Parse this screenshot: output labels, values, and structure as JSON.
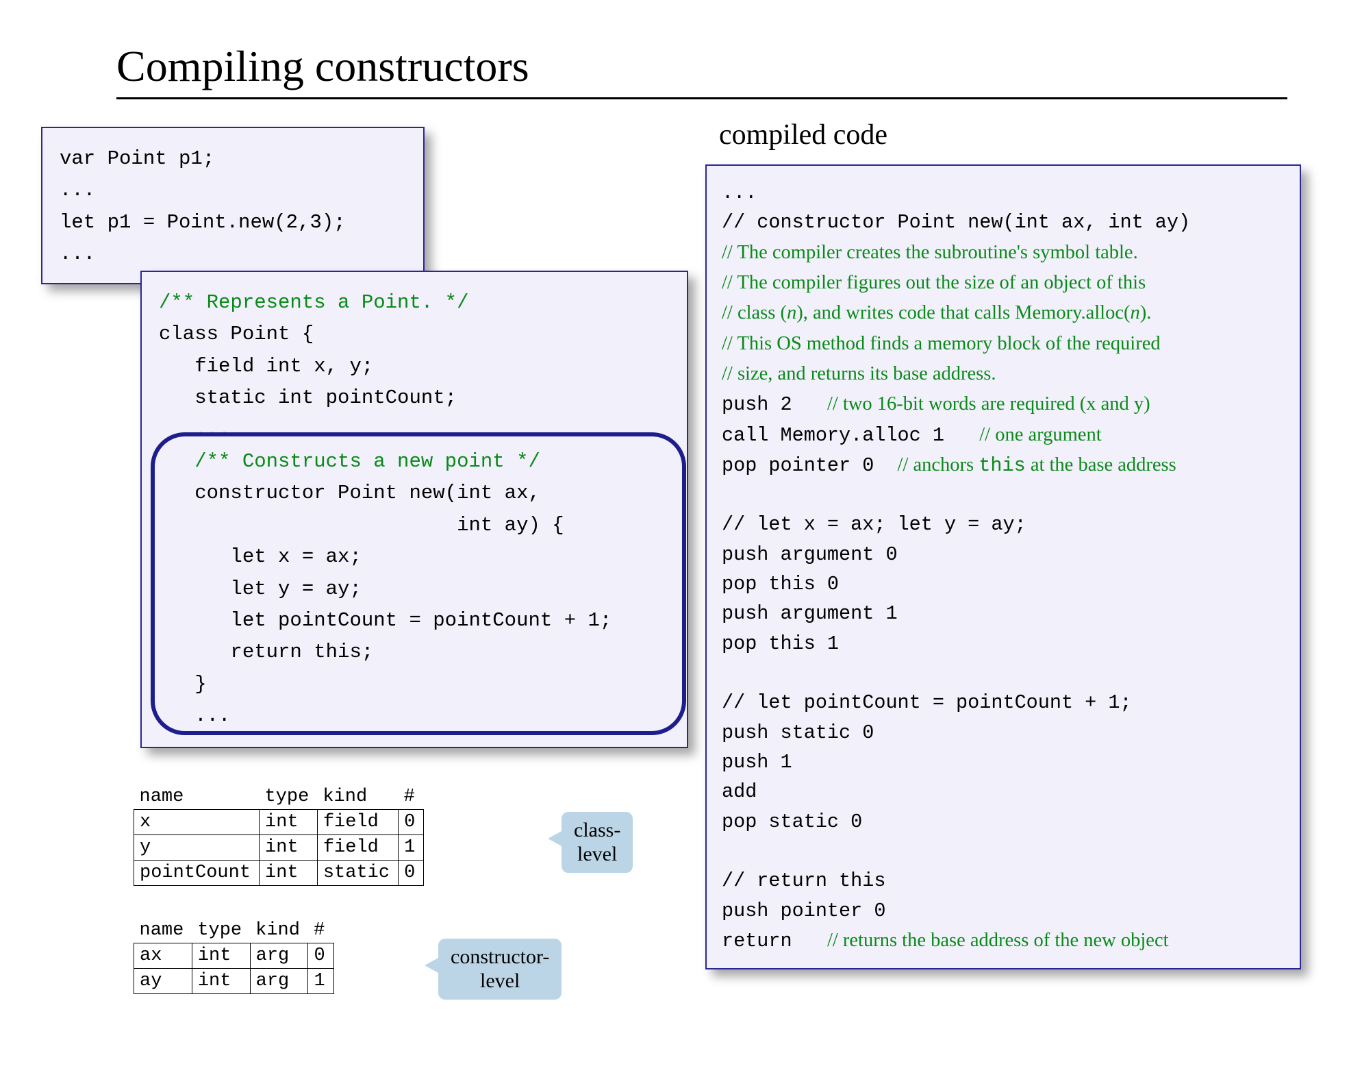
{
  "title": "Compiling constructors",
  "snippet": [
    {
      "t": "var Point p1;"
    },
    {
      "t": "..."
    },
    {
      "t": "let p1 = Point.new(2,3);"
    },
    {
      "t": "..."
    }
  ],
  "class_code": [
    {
      "t": "/** Represents a Point. */",
      "cls": "green"
    },
    {
      "t": "class Point {"
    },
    {
      "t": "   field int x, y;"
    },
    {
      "t": "   static int pointCount;"
    },
    {
      "t": "   ..."
    },
    {
      "t": "   /** Constructs a new point */",
      "cls": "green"
    },
    {
      "t": "   constructor Point new(int ax,"
    },
    {
      "t": "                         int ay) {"
    },
    {
      "t": "      let x = ax;"
    },
    {
      "t": "      let y = ay;"
    },
    {
      "t": "      let pointCount = pointCount + 1;"
    },
    {
      "t": "      return this;"
    },
    {
      "t": "   }"
    },
    {
      "t": "   ..."
    }
  ],
  "class_table": {
    "headers": [
      "name",
      "type",
      "kind",
      "#"
    ],
    "rows": [
      [
        "x",
        "int",
        "field",
        "0"
      ],
      [
        "y",
        "int",
        "field",
        "1"
      ],
      [
        "pointCount",
        "int",
        "static",
        "0"
      ]
    ]
  },
  "sub_table": {
    "headers": [
      "name",
      "type",
      "kind",
      "#"
    ],
    "rows": [
      [
        "ax",
        "int",
        "arg",
        "0"
      ],
      [
        "ay",
        "int",
        "arg",
        "1"
      ]
    ]
  },
  "callout_class": "class-\nlevel",
  "callout_sub": "constructor-\nlevel",
  "right_heading": "compiled code",
  "compiled": [
    {
      "segs": [
        {
          "t": "...",
          "k": "mono"
        }
      ]
    },
    {
      "segs": [
        {
          "t": "// constructor Point new(int ax, int ay)",
          "k": "mono"
        }
      ]
    },
    {
      "segs": [
        {
          "t": "// The compiler creates the subroutine's symbol table.",
          "k": "sg"
        }
      ]
    },
    {
      "segs": [
        {
          "t": "// The compiler figures out the size of an object of this",
          "k": "sg"
        }
      ]
    },
    {
      "segs": [
        {
          "t": "// class (",
          "k": "sg"
        },
        {
          "t": "n",
          "k": "sgi"
        },
        {
          "t": "), and writes code that calls Memory.alloc(",
          "k": "sg"
        },
        {
          "t": "n",
          "k": "sgi"
        },
        {
          "t": ").",
          "k": "sg"
        }
      ]
    },
    {
      "segs": [
        {
          "t": "// This OS method finds a memory block of the required",
          "k": "sg"
        }
      ]
    },
    {
      "segs": [
        {
          "t": "// size, and returns its base address.",
          "k": "sg"
        }
      ]
    },
    {
      "segs": [
        {
          "t": "push 2   ",
          "k": "mono"
        },
        {
          "t": "// two 16-bit words are required (x and y)",
          "k": "sg"
        }
      ]
    },
    {
      "segs": [
        {
          "t": "call Memory.alloc 1   ",
          "k": "mono"
        },
        {
          "t": "// one argument",
          "k": "sg"
        }
      ]
    },
    {
      "segs": [
        {
          "t": "pop pointer 0  ",
          "k": "mono"
        },
        {
          "t": "// anchors ",
          "k": "sg"
        },
        {
          "t": "this",
          "k": "sgmono"
        },
        {
          "t": " at the base address",
          "k": "sg"
        }
      ]
    },
    {
      "blank": true
    },
    {
      "segs": [
        {
          "t": "// let x = ax; let y = ay;",
          "k": "mono"
        }
      ]
    },
    {
      "segs": [
        {
          "t": "push argument 0",
          "k": "mono"
        }
      ]
    },
    {
      "segs": [
        {
          "t": "pop this 0",
          "k": "mono"
        }
      ]
    },
    {
      "segs": [
        {
          "t": "push argument 1",
          "k": "mono"
        }
      ]
    },
    {
      "segs": [
        {
          "t": "pop this 1",
          "k": "mono"
        }
      ]
    },
    {
      "blank": true
    },
    {
      "segs": [
        {
          "t": "// let pointCount = pointCount + 1;",
          "k": "mono"
        }
      ]
    },
    {
      "segs": [
        {
          "t": "push static 0",
          "k": "mono"
        }
      ]
    },
    {
      "segs": [
        {
          "t": "push 1",
          "k": "mono"
        }
      ]
    },
    {
      "segs": [
        {
          "t": "add",
          "k": "mono"
        }
      ]
    },
    {
      "segs": [
        {
          "t": "pop static 0",
          "k": "mono"
        }
      ]
    },
    {
      "blank": true
    },
    {
      "segs": [
        {
          "t": "// return this",
          "k": "mono"
        }
      ]
    },
    {
      "segs": [
        {
          "t": "push pointer 0",
          "k": "mono"
        }
      ]
    },
    {
      "segs": [
        {
          "t": "return   ",
          "k": "mono"
        },
        {
          "t": "// returns the base address of the new object",
          "k": "sg"
        }
      ]
    }
  ]
}
